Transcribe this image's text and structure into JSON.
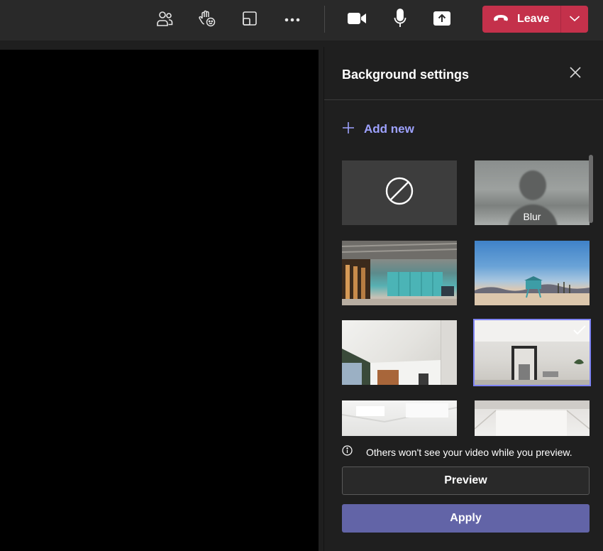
{
  "toolbar": {
    "leave_label": "Leave",
    "icons": [
      "participants-icon",
      "raise-hand-icon",
      "view-icon",
      "more-icon",
      "camera-icon",
      "mic-icon",
      "share-icon",
      "phone-hangup-icon",
      "chevron-down-icon"
    ]
  },
  "panel": {
    "title": "Background settings",
    "add_new_label": "Add new",
    "thumbnails": [
      {
        "name": "none",
        "label": ""
      },
      {
        "name": "blur",
        "label": "Blur"
      },
      {
        "name": "office",
        "label": ""
      },
      {
        "name": "beach",
        "label": ""
      },
      {
        "name": "room-1",
        "label": ""
      },
      {
        "name": "room-2",
        "label": "",
        "selected": true
      },
      {
        "name": "room-3",
        "label": ""
      },
      {
        "name": "room-4",
        "label": ""
      }
    ],
    "info_text": "Others won't see your video while you preview.",
    "preview_label": "Preview",
    "apply_label": "Apply"
  },
  "colors": {
    "leave": "#c4314b",
    "accent": "#6264a7",
    "link": "#9ea2ff",
    "selection": "#7f85f5"
  }
}
